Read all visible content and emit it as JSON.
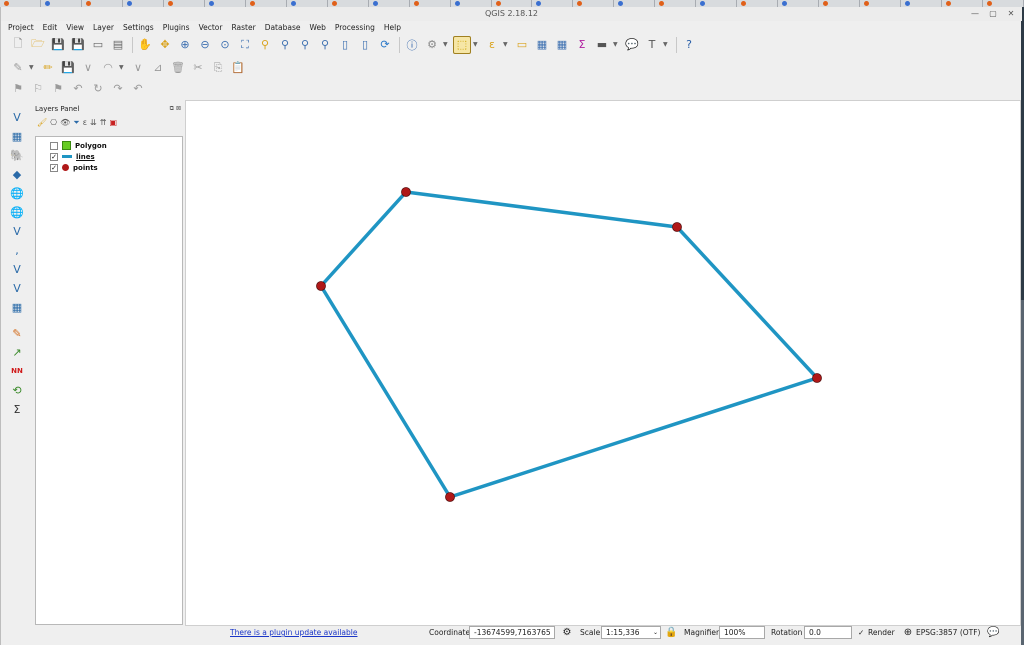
{
  "window": {
    "title": "QGIS 2.18.12"
  },
  "menu": [
    "Project",
    "Edit",
    "View",
    "Layer",
    "Settings",
    "Plugins",
    "Vector",
    "Raster",
    "Database",
    "Web",
    "Processing",
    "Help"
  ],
  "layers_panel": {
    "title": "Layers Panel",
    "layers": [
      {
        "name": "Polygon",
        "checked": false,
        "symbol": "polygon-fill-square",
        "color": "#66cc22"
      },
      {
        "name": "lines",
        "checked": true,
        "symbol": "line-stroke",
        "color": "#1f95c3"
      },
      {
        "name": "points",
        "checked": true,
        "symbol": "point-circle",
        "color": "#b01818"
      }
    ]
  },
  "map": {
    "line_color": "#1f95c3",
    "point_color": "#b01818"
  },
  "status": {
    "plugin_update": "There is a plugin update available",
    "coordinate_label": "Coordinate",
    "coordinate_value": "-13674599,7163765",
    "scale_label": "Scale",
    "scale_value": "1:15,336",
    "magnifier_label": "Magnifier",
    "magnifier_value": "100%",
    "rotation_label": "Rotation",
    "rotation_value": "0.0",
    "render_label": "Render",
    "render_checked": true,
    "crs": "EPSG:3857 (OTF)"
  }
}
